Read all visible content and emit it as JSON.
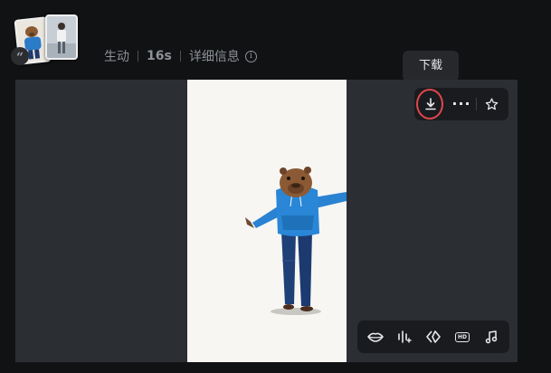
{
  "header": {
    "type_label": "生动",
    "duration": "16s",
    "details_label": "详细信息",
    "quote_icon": "quote-icon",
    "info_icon": "info-icon"
  },
  "tooltip": {
    "text": "下载"
  },
  "video": {
    "watermark": "",
    "background_color": "#f7f6f3"
  },
  "action_bar": {
    "download_icon": "download-icon",
    "more_icon": "more-icon",
    "favorite_icon": "star-icon",
    "highlight_color": "#e0474c"
  },
  "tools_bar": {
    "items": [
      {
        "icon": "lips-icon"
      },
      {
        "icon": "audio-wave-icon"
      },
      {
        "icon": "diamond-arrows-icon"
      },
      {
        "icon": "hd-icon",
        "label": "HD"
      },
      {
        "icon": "music-note-icon"
      }
    ]
  }
}
